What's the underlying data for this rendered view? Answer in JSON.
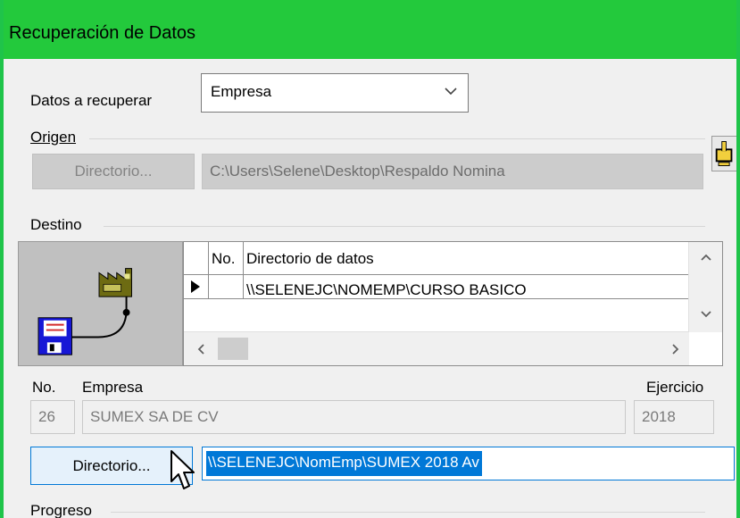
{
  "window": {
    "title": "Recuperación de Datos"
  },
  "datos": {
    "label": "Datos a recuperar",
    "selected": "Empresa"
  },
  "origen": {
    "group_label": "Origen",
    "directory_button": "Directorio...",
    "path": "C:\\Users\\Selene\\Desktop\\Respaldo Nomina"
  },
  "destino": {
    "group_label": "Destino",
    "grid": {
      "columns": [
        "No.",
        "Directorio de datos"
      ],
      "rows": [
        {
          "no": "",
          "directorio": "\\\\SELENEJC\\NOMEMP\\CURSO BASICO"
        }
      ]
    },
    "no_label": "No.",
    "empresa_label": "Empresa",
    "ejercicio_label": "Ejercicio",
    "no_value": "26",
    "empresa_value": "SUMEX SA DE CV",
    "ejercicio_value": "2018",
    "directory_button": "Directorio...",
    "directory_value": "\\\\SELENEJC\\NomEmp\\SUMEX 2018 Av"
  },
  "progreso": {
    "group_label": "Progreso"
  },
  "icons": {
    "picker": "hand-pointer-icon",
    "art": "factory-floppy-icon",
    "combo": "chevron-down-icon"
  },
  "colors": {
    "titlebar": "#23c93c",
    "accent": "#0078d7"
  }
}
